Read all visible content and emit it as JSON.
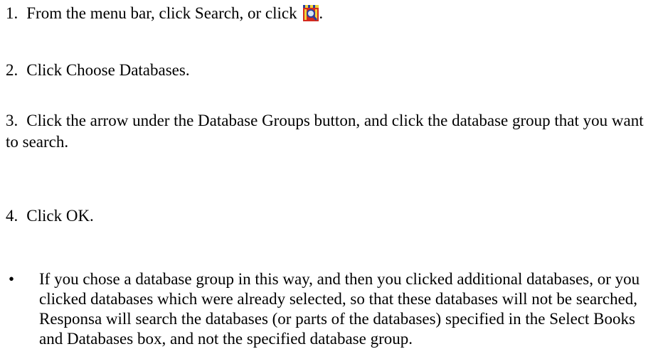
{
  "steps": {
    "s1": {
      "num": "1.",
      "text_before_icon": "From the menu bar, click Search, or click",
      "text_after_icon": ".",
      "icon": "search-toolbar-icon"
    },
    "s2": {
      "num": "2.",
      "text": "Click Choose Databases."
    },
    "s3": {
      "num": "3.",
      "text": "Click the arrow under the Database Groups button, and click the database group that you want to search."
    },
    "s4": {
      "num": "4.",
      "text": "Click OK."
    }
  },
  "bullet": {
    "marker": "•",
    "text": "If you chose a database group in this way, and then you clicked additional databases, or you clicked databases which were already selected, so that these databases will not be searched, Responsa will search the databases (or parts of the databases) specified in the Select Books and Databases box, and not the specified database group."
  },
  "colors": {
    "icon_red": "#d42a1e",
    "icon_yellow": "#f2d43a",
    "icon_blue": "#2a3f9e"
  }
}
